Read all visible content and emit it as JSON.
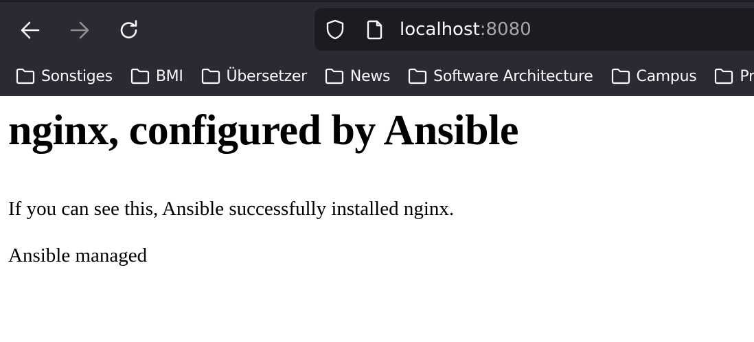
{
  "browser": {
    "nav": {
      "back_icon": "arrow-left-icon",
      "forward_icon": "arrow-right-icon",
      "reload_icon": "reload-icon",
      "forward_enabled": false
    },
    "urlbar": {
      "security_icon": "shield-icon",
      "page_icon": "page-icon",
      "host": "localhost",
      "port": ":8080"
    },
    "bookmarks": [
      {
        "label": "Sonstiges",
        "icon": "folder-icon"
      },
      {
        "label": "BMI",
        "icon": "folder-icon"
      },
      {
        "label": "Übersetzer",
        "icon": "folder-icon"
      },
      {
        "label": "News",
        "icon": "folder-icon"
      },
      {
        "label": "Software Architecture",
        "icon": "folder-icon"
      },
      {
        "label": "Campus",
        "icon": "folder-icon"
      },
      {
        "label": "Pr",
        "icon": "folder-icon"
      }
    ],
    "colors": {
      "toolbar_bg": "#2b2a33",
      "urlbar_bg": "#1c1b22",
      "text": "#fbfbfe",
      "muted": "#a6a6ab"
    }
  },
  "page": {
    "heading": "nginx, configured by Ansible",
    "paragraph_1": "If you can see this, Ansible successfully installed nginx.",
    "paragraph_2": "Ansible managed"
  }
}
